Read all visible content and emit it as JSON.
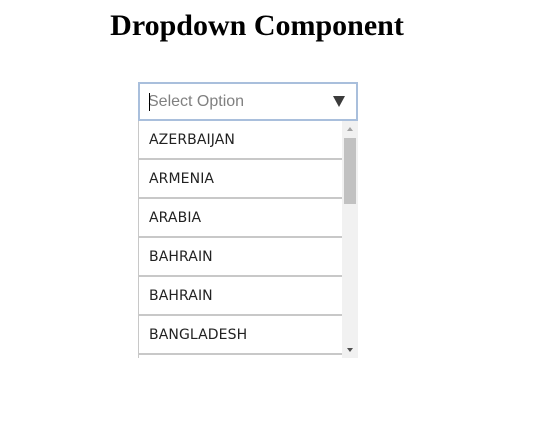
{
  "page": {
    "title": "Dropdown Component"
  },
  "dropdown": {
    "placeholder": "Select Option",
    "value": "",
    "arrow_icon": "triangle-down-icon",
    "options": [
      "AZERBAIJAN",
      "ARMENIA",
      "ARABIA",
      "BAHRAIN",
      "BAHRAIN",
      "BANGLADESH",
      ""
    ],
    "list_scroll_position": 0.0
  },
  "colors": {
    "input_border": "#a9bfdc",
    "option_border": "#c8c8c8",
    "scroll_track": "#f1f1f1",
    "scroll_thumb": "#c1c1c1"
  }
}
